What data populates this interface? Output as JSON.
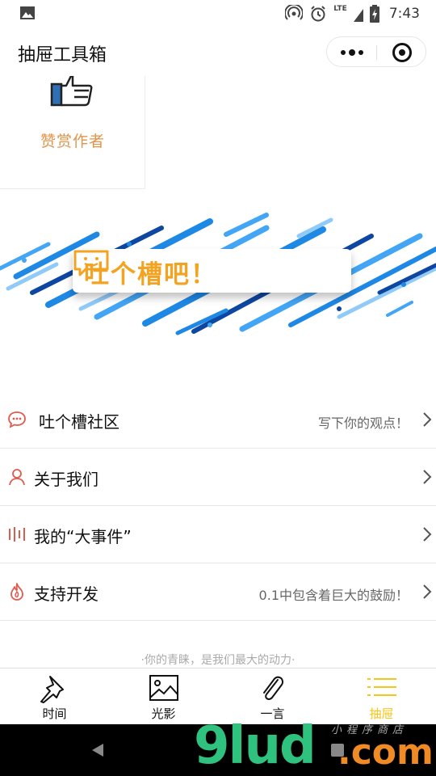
{
  "status_bar": {
    "time": "7:43",
    "network": "LTE",
    "icons": [
      "image-icon",
      "hotspot-icon",
      "alarm-icon",
      "signal-icon",
      "battery-charging-icon"
    ]
  },
  "title_bar": {
    "title": "抽屉工具箱",
    "capsule_icons": [
      "more-dots-icon",
      "close-target-icon"
    ]
  },
  "praise": {
    "label": "赞赏作者",
    "icon": "thumbs-up-icon",
    "color": "#e2944a"
  },
  "banner": {
    "text": "吐个槽吧！",
    "icon": "chat-smile-icon",
    "text_color": "#f2a322",
    "stripe_colors": [
      "#1e88e5",
      "#42a5f5",
      "#90caf9",
      "#0d47a1"
    ]
  },
  "menu": [
    {
      "icon": "chat-bubble-icon",
      "label": "吐个槽社区",
      "hint": "写下你的观点！",
      "icon_color": "#e05a4f"
    },
    {
      "icon": "person-icon",
      "label": "关于我们",
      "hint": "",
      "icon_color": "#e05a4f"
    },
    {
      "icon": "bars-icon",
      "label": "我的“大事件”",
      "hint": "",
      "icon_color": "#e05a4f"
    },
    {
      "icon": "flame-icon",
      "label": "支持开发",
      "hint": "0.1中包含着巨大的鼓励！",
      "icon_color": "#e05a4f"
    }
  ],
  "footer_tagline": "·你的青睐，是我们最大的动力·",
  "tabs": [
    {
      "label": "时间",
      "icon": "pin-icon",
      "active": false
    },
    {
      "label": "光影",
      "icon": "picture-icon",
      "active": false
    },
    {
      "label": "一言",
      "icon": "paperclip-icon",
      "active": false
    },
    {
      "label": "抽屉",
      "icon": "list-icon",
      "active": true
    }
  ],
  "active_color": "#f5c518",
  "watermark": {
    "main": "9lud",
    "suffix": ".com",
    "small": "小程序商店"
  }
}
